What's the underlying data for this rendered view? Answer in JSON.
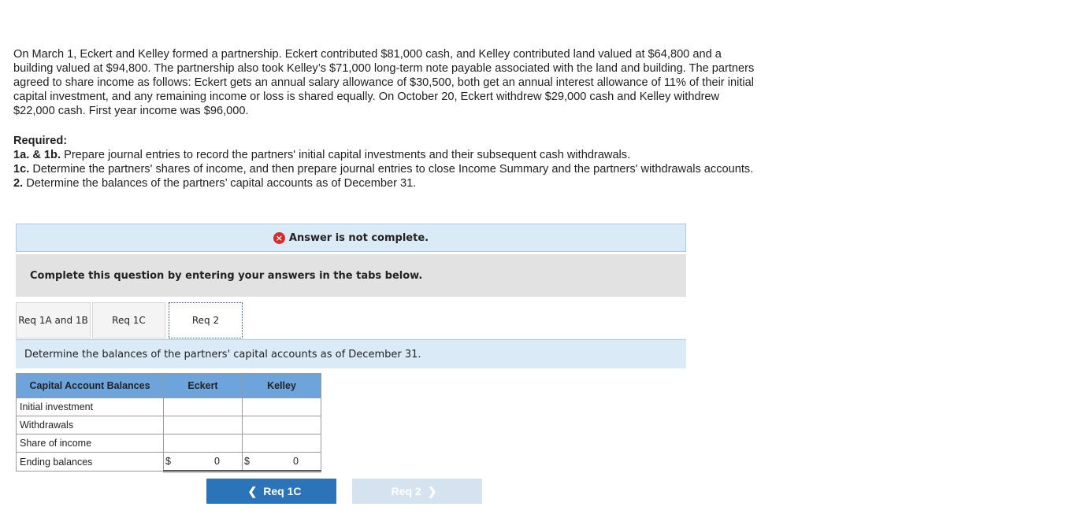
{
  "problem": {
    "paragraph": "On March 1, Eckert and Kelley formed a partnership. Eckert contributed $81,000 cash, and Kelley contributed land valued at $64,800 and a building valued at $94,800. The partnership also took Kelley’s $71,000 long-term note payable associated with the land and building. The partners agreed to share income as follows: Eckert gets an annual salary allowance of $30,500, both get an annual interest allowance of 11% of their initial capital investment, and any remaining income or loss is shared equally. On October 20, Eckert withdrew $29,000 cash and Kelley withdrew $22,000 cash. First year income was $96,000.",
    "required_heading": "Required:",
    "req1_label": "1a. & 1b.",
    "req1_text": " Prepare journal entries to record the partners' initial capital investments and their subsequent cash withdrawals.",
    "req2_label": "1c.",
    "req2_text": " Determine the partners' shares of income, and then prepare journal entries to close Income Summary and the partners' withdrawals accounts.",
    "req3_label": "2.",
    "req3_text": " Determine the balances of the partners’ capital accounts as of December 31."
  },
  "status": {
    "icon": "×",
    "text": "Answer is not complete."
  },
  "instruction": "Complete this question by entering your answers in the tabs below.",
  "tabs": [
    {
      "label": "Req 1A and 1B"
    },
    {
      "label": "Req 1C"
    },
    {
      "label": "Req 2"
    }
  ],
  "panel_header": "Determine the balances of the partners' capital accounts as of December 31.",
  "table": {
    "headers": [
      "Capital Account Balances",
      "Eckert",
      "Kelley"
    ],
    "rows": [
      {
        "label": "Initial investment"
      },
      {
        "label": "Withdrawals"
      },
      {
        "label": "Share of income"
      },
      {
        "label": "Ending balances",
        "eckert_sign": "$",
        "eckert_value": "0",
        "kelley_sign": "$",
        "kelley_value": "0"
      }
    ]
  },
  "nav": {
    "prev_label": "Req 1C",
    "next_label": "Req 2"
  }
}
